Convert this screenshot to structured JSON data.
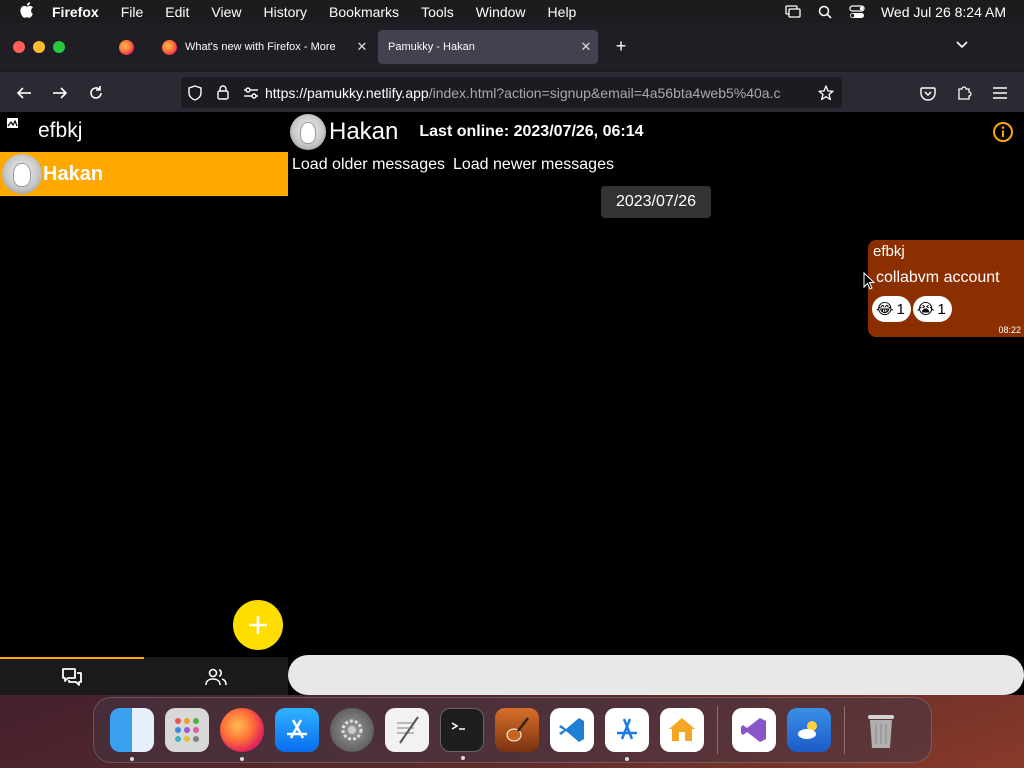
{
  "menubar": {
    "app_name": "Firefox",
    "items": [
      "File",
      "Edit",
      "View",
      "History",
      "Bookmarks",
      "Tools",
      "Window",
      "Help"
    ],
    "clock": "Wed Jul 26  8:24 AM"
  },
  "browser": {
    "tabs": [
      {
        "title": "What's new with Firefox - More",
        "active": false
      },
      {
        "title": "Pamukky - Hakan",
        "active": true
      }
    ],
    "url_domain": "https://pamukky.netlify.app",
    "url_path": "/index.html?action=signup&email=4a56bta4web5%40a.c"
  },
  "app": {
    "self_name": "efbkj",
    "contacts": [
      {
        "name": "Hakan",
        "selected": true
      }
    ],
    "chat": {
      "peer_name": "Hakan",
      "last_online": "Last online: 2023/07/26, 06:14",
      "load_older": "Load older messages",
      "load_newer": "Load newer messages",
      "date_chip": "2023/07/26",
      "messages": [
        {
          "sender": "efbkj",
          "text": "collabvm account",
          "time": "08:22",
          "reactions": [
            {
              "emoji": "😂",
              "count": "1"
            },
            {
              "emoji": "😭",
              "count": "1"
            }
          ]
        }
      ]
    }
  },
  "colors": {
    "accent": "#ffa800",
    "fab": "#ffdd00",
    "message_bg": "#8b2e00"
  },
  "dock": {
    "apps": [
      "finder-icon",
      "launchpad-icon",
      "firefox-icon",
      "app-store-icon",
      "system-settings-icon",
      "textedit-icon",
      "terminal-icon",
      "garageband-icon",
      "vscode-icon",
      "accessibility-inspector-icon",
      "home-icon",
      "visual-studio-icon",
      "weather-icon",
      "trash-icon"
    ]
  }
}
